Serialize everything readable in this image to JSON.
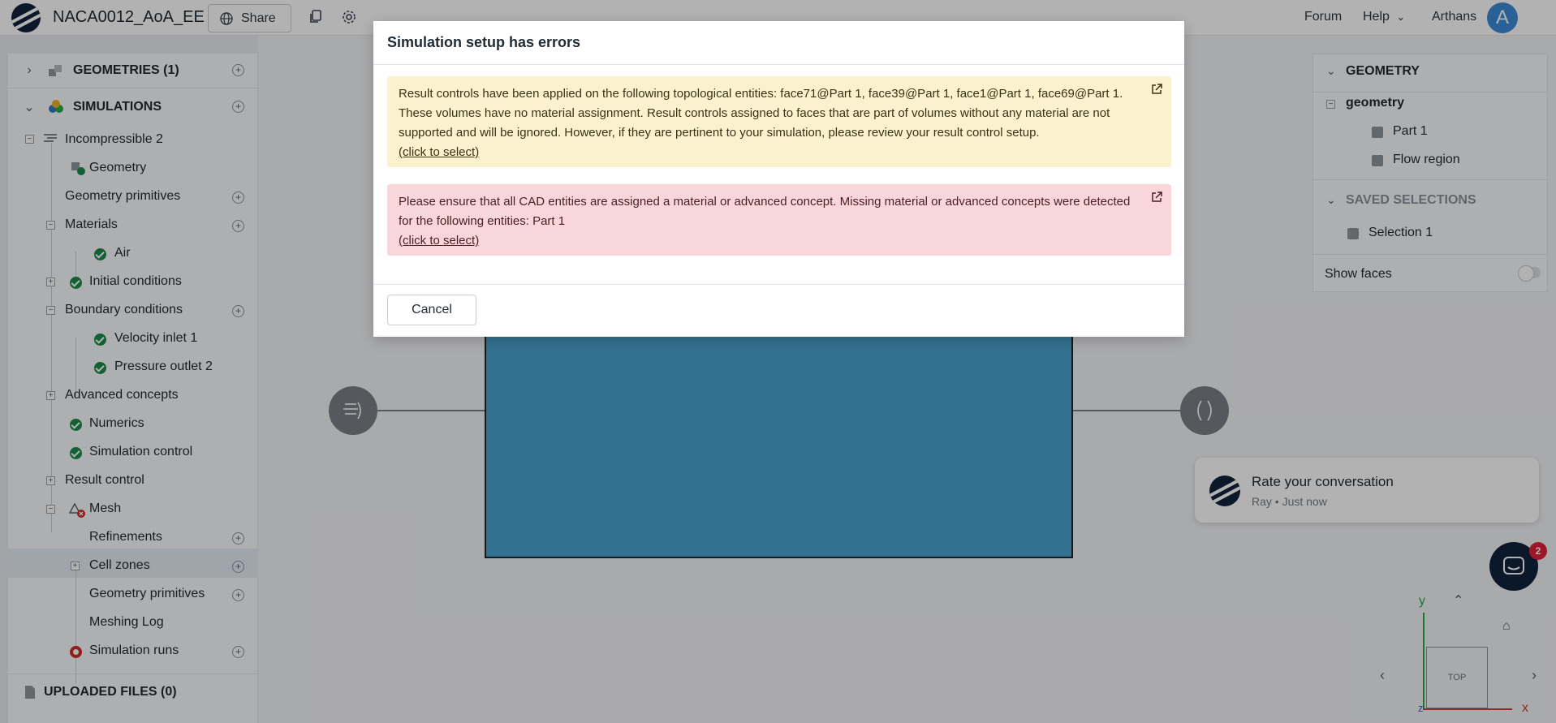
{
  "header": {
    "project_title": "NACA0012_AoA_EE",
    "share_label": "Share",
    "forum_label": "Forum",
    "help_label": "Help",
    "user_name": "Arthans",
    "avatar_letter": "A",
    "avatar_color": "#3b8ad6"
  },
  "sidebar": {
    "geometries_label": "GEOMETRIES (1)",
    "simulations_label": "SIMULATIONS",
    "uploaded_files_label": "UPLOADED FILES (0)",
    "tree": {
      "incompressible": "Incompressible 2",
      "geometry": "Geometry",
      "geometry_primitives": "Geometry primitives",
      "materials": "Materials",
      "air": "Air",
      "initial_conditions": "Initial conditions",
      "boundary_conditions": "Boundary conditions",
      "velocity_inlet": "Velocity inlet 1",
      "pressure_outlet": "Pressure outlet 2",
      "advanced_concepts": "Advanced concepts",
      "numerics": "Numerics",
      "simulation_control": "Simulation control",
      "result_control": "Result control",
      "mesh": "Mesh",
      "refinements": "Refinements",
      "cell_zones": "Cell zones",
      "mesh_geometry_primitives": "Geometry primitives",
      "meshing_log": "Meshing Log",
      "simulation_runs": "Simulation runs"
    }
  },
  "geometry_panel": {
    "geometry_header": "GEOMETRY",
    "geometry_root": "geometry",
    "part1": "Part 1",
    "flow_region": "Flow region",
    "saved_selections_header": "SAVED SELECTIONS",
    "selection1": "Selection 1",
    "show_faces": "Show faces"
  },
  "viewport": {
    "axis_y": "y",
    "axis_x": "x",
    "axis_z": "z",
    "navcube_face": "TOP"
  },
  "toast": {
    "title": "Rate your conversation",
    "subtitle": "Ray • Just now",
    "badge_count": "2"
  },
  "modal": {
    "title": "Simulation setup has errors",
    "warning_text": "Result controls have been applied on the following topological entities: face71@Part 1, face39@Part 1, face1@Part 1, face69@Part 1. These volumes have no material assignment. Result controls assigned to faces that are part of volumes without any material are not supported and will be ignored. However, if they are pertinent to your simulation, please review your result control setup.",
    "warning_link": "(click to select)",
    "error_text": "Please ensure that all CAD entities are assigned a material or advanced concept. Missing material or advanced concepts were detected for the following entities: Part 1",
    "error_link": "(click to select)",
    "cancel_label": "Cancel"
  },
  "colors": {
    "warning_bg": "#fbf1cc",
    "error_bg": "#f9d6da",
    "success": "#1e8a4c",
    "danger": "#d12a2a",
    "geometry_fill": "#4aa2cf"
  }
}
